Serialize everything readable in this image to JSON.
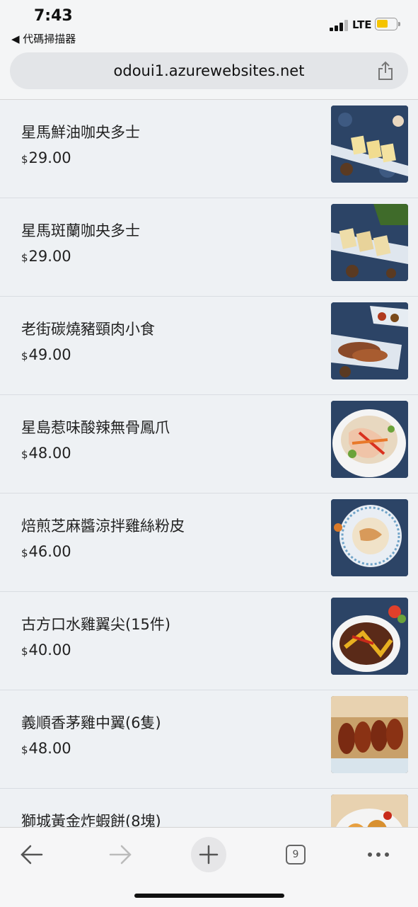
{
  "status": {
    "time": "7:43",
    "back_label": "◀ 代碼掃描器",
    "network": "LTE"
  },
  "browser": {
    "url": "odoui1.azurewebsites.net",
    "tab_count": "9"
  },
  "currency": "$",
  "items": [
    {
      "name": "星馬鮮油咖央多士",
      "price": "29.00"
    },
    {
      "name": "星馬斑蘭咖央多士",
      "price": "29.00"
    },
    {
      "name": "老街碳燒豬頸肉小食",
      "price": "49.00"
    },
    {
      "name": "星島惹味酸辣無骨鳳爪",
      "price": "48.00"
    },
    {
      "name": "焙煎芝麻醬涼拌雞絲粉皮",
      "price": "46.00"
    },
    {
      "name": "古方口水雞翼尖(15件)",
      "price": "40.00"
    },
    {
      "name": "義順香茅雞中翼(6隻)",
      "price": "48.00"
    },
    {
      "name": "獅城黃金炸蝦餅(8塊)",
      "price": ""
    }
  ],
  "colors": {
    "battery": "#f5c400",
    "background": "#eef1f4"
  }
}
